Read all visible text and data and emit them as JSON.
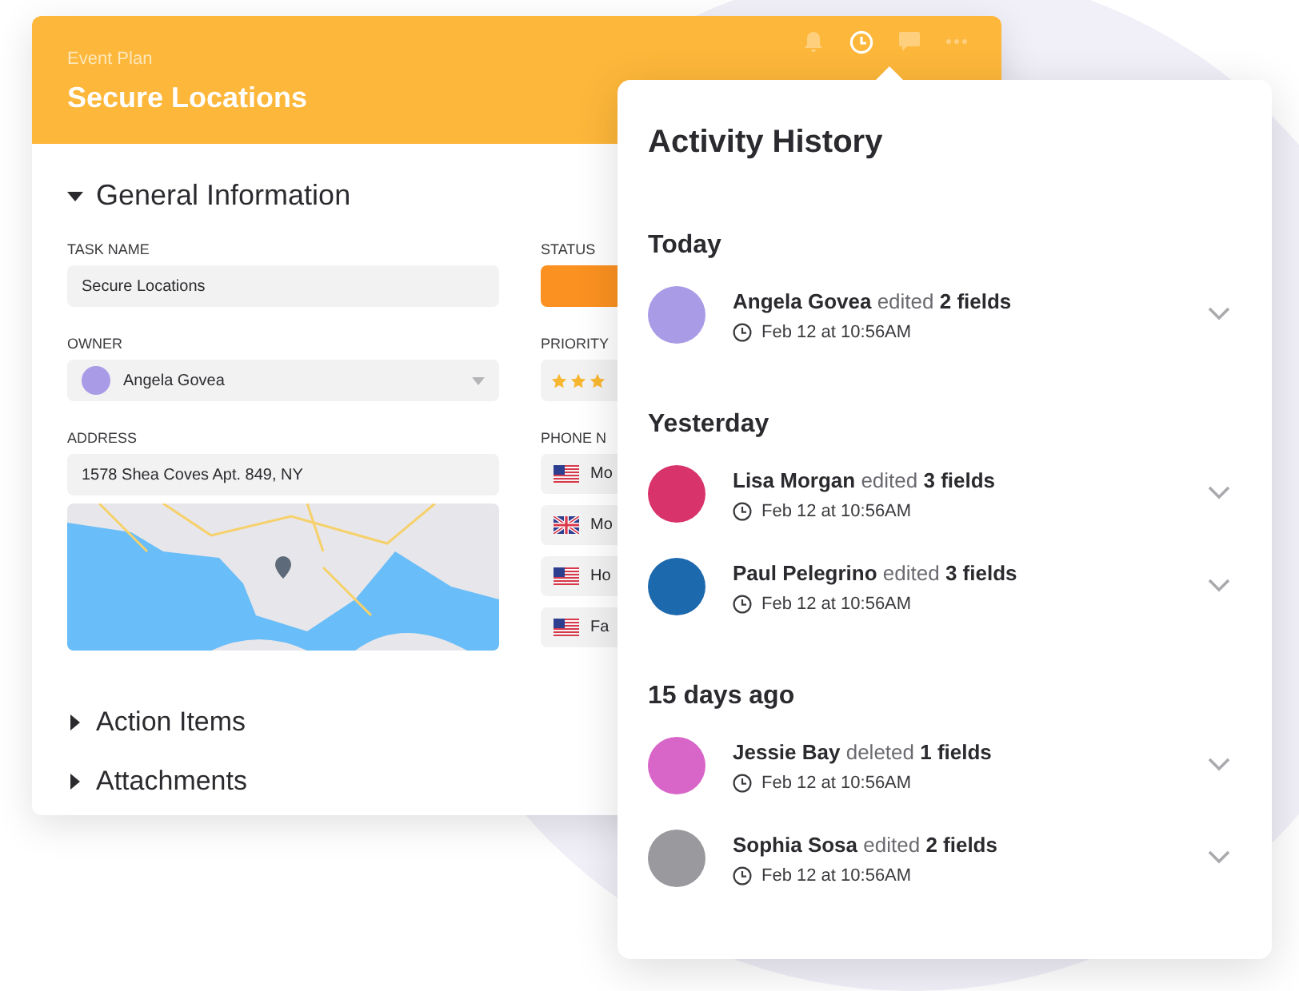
{
  "card": {
    "eyebrow": "Event Plan",
    "title": "Secure Locations",
    "header_actions": [
      {
        "kind": "bell",
        "selected": false
      },
      {
        "kind": "clock",
        "selected": true
      },
      {
        "kind": "chat",
        "selected": false
      },
      {
        "kind": "more",
        "selected": false
      }
    ],
    "sections": [
      {
        "title": "General Information",
        "expanded": true
      },
      {
        "title": "Action Items",
        "expanded": false
      },
      {
        "title": "Attachments",
        "expanded": false
      }
    ],
    "fields": {
      "task_name": {
        "label": "TASK NAME",
        "value": "Secure Locations"
      },
      "owner": {
        "label": "OWNER",
        "value": "Angela Govea"
      },
      "address": {
        "label": "ADDRESS",
        "value": "1578 Shea Coves Apt. 849, NY"
      },
      "status": {
        "label": "STATUS",
        "color": "#fb9120"
      },
      "priority": {
        "label": "PRIORITY",
        "stars": 3
      },
      "phone_numbers": {
        "label": "PHONE N",
        "items": [
          {
            "kind": "us",
            "text": "Mo"
          },
          {
            "kind": "uk",
            "text": "Mo"
          },
          {
            "kind": "us",
            "text": "Ho"
          },
          {
            "kind": "us",
            "text": "Fa"
          }
        ]
      }
    }
  },
  "activity": {
    "title": "Activity History",
    "groups": [
      {
        "label": "Today",
        "items": [
          {
            "text": "**Angela Govea** edited **2 fields**",
            "time": "Feb 12 at 10:56AM",
            "color": "#a99be6",
            "expanded": false
          }
        ]
      },
      {
        "label": "Yesterday",
        "items": [
          {
            "text": "**Lisa Morgan** edited **3 fields**",
            "time": "Feb 12 at 10:56AM",
            "color": "#d8336a",
            "expanded": false
          },
          {
            "text": "**Paul Pelegrino** edited **3 fields**",
            "time": "Feb 12 at 10:56AM",
            "color": "#1d69ad",
            "expanded": false
          }
        ]
      },
      {
        "label": "15 days ago",
        "items": [
          {
            "text": "**Jessie Bay** deleted **1 fields**",
            "time": "Feb 12 at 10:56AM",
            "color": "#d866c8",
            "expanded": false
          },
          {
            "text": "**Sophia Sosa** edited **2 fields**",
            "time": "Feb 12 at 10:56AM",
            "color": "#9a9a9e",
            "expanded": false
          }
        ]
      }
    ]
  }
}
